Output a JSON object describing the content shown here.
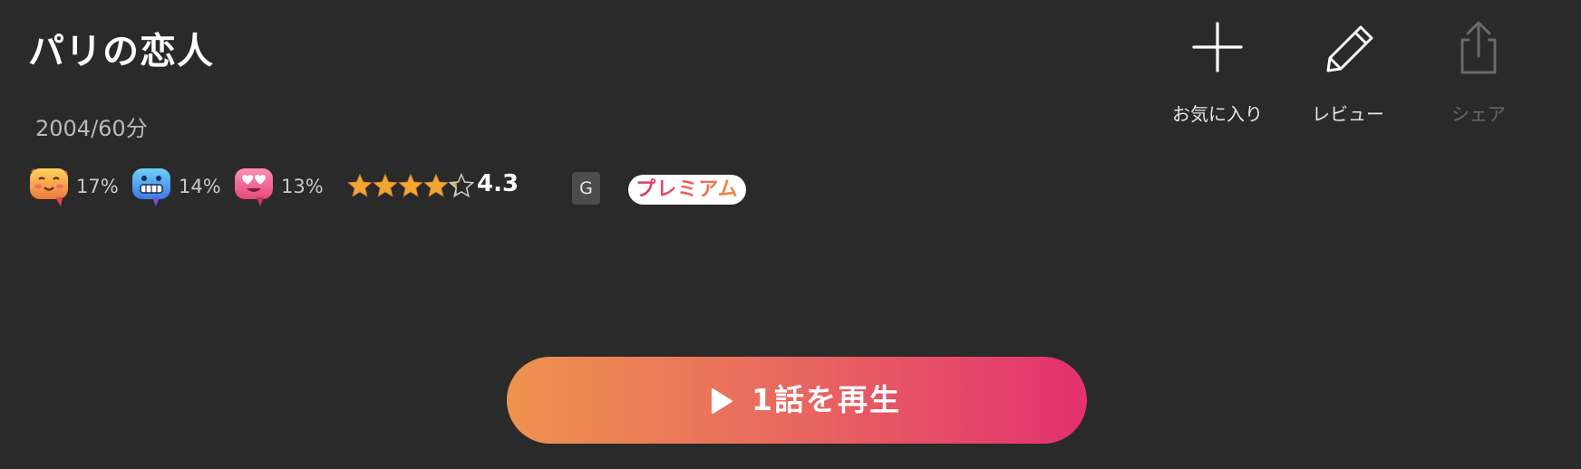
{
  "title": "パリの恋人",
  "meta": "2004/60分",
  "reactions": [
    {
      "icon": "blush-face-bubble-icon",
      "percent": "17%"
    },
    {
      "icon": "grimace-face-bubble-icon",
      "percent": "14%"
    },
    {
      "icon": "heart-eyes-face-bubble-icon",
      "percent": "13%"
    }
  ],
  "rating": {
    "value": "4.3",
    "stars_max": 5,
    "stars_filled": 4.3
  },
  "age_rating": "G",
  "premium_label": "プレミアム",
  "actions": [
    {
      "icon": "plus-icon",
      "label": "お気に入り",
      "enabled": true
    },
    {
      "icon": "pencil-icon",
      "label": "レビュー",
      "enabled": true
    },
    {
      "icon": "share-icon",
      "label": "シェア",
      "enabled": false
    }
  ],
  "play_button": {
    "icon": "play-icon",
    "label": "1話を再生"
  },
  "colors": {
    "background": "#2a2a2a",
    "gradient_start": "#ee924e",
    "gradient_end": "#e3306f",
    "star": "#f2a634"
  }
}
